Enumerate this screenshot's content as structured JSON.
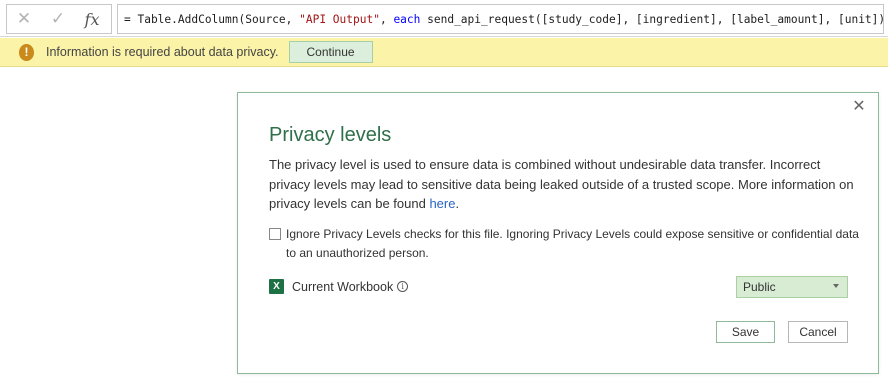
{
  "formula_bar": {
    "cancel_icon": "close-icon",
    "cancel_glyph": "✕",
    "commit_icon": "checkmark-icon",
    "commit_glyph": "✓",
    "fx_label": "fx",
    "formula_prefix": "= Table.AddColumn(Source, ",
    "formula_string": "\"API Output\"",
    "formula_mid": ", ",
    "formula_keyword": "each",
    "formula_suffix": " send_api_request([study_code], [ingredient], [label_amount], [unit]))"
  },
  "info_bar": {
    "icon": "warning-icon",
    "icon_glyph": "!",
    "message": "Information is required about data privacy.",
    "continue_label": "Continue",
    "background": "#fbf3a8"
  },
  "dialog": {
    "close_glyph": "✕",
    "title": "Privacy levels",
    "description": "The privacy level is used to ensure data is combined without undesirable data transfer. Incorrect privacy levels may lead to sensitive data being leaked outside of a trusted scope. More information on privacy levels can be found ",
    "link_text": "here",
    "description_end": ".",
    "checkbox_label": "Ignore Privacy Levels checks for this file. Ignoring Privacy Levels could expose sensitive or confidential data to an unauthorized person.",
    "checkbox_checked": false,
    "source": {
      "icon": "excel-icon",
      "icon_glyph": "X",
      "label": "Current Workbook",
      "info_glyph": "i",
      "privacy_level": "Public"
    },
    "save_label": "Save",
    "cancel_label": "Cancel",
    "accent_color": "#2f6f49"
  }
}
